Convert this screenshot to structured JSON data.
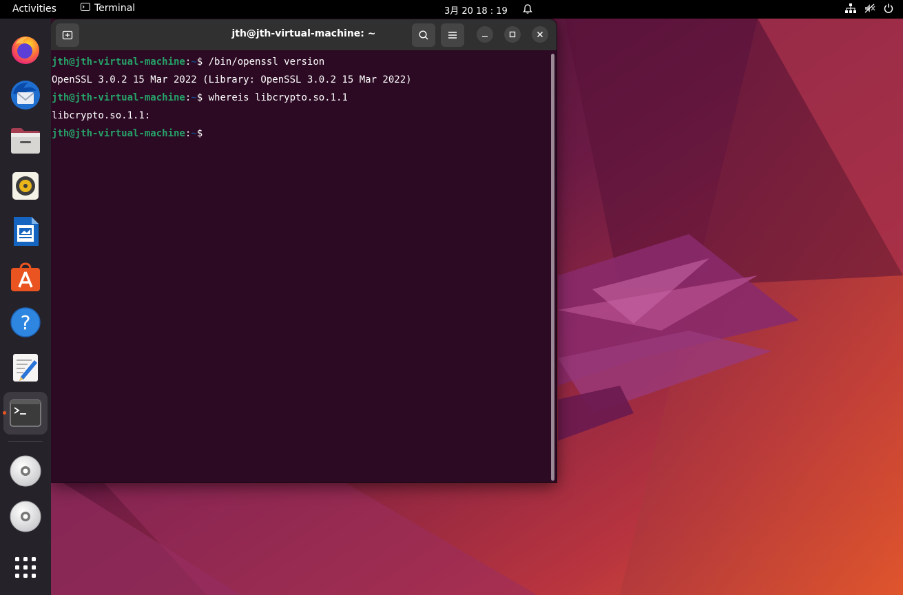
{
  "topbar": {
    "activities": "Activities",
    "app_name": "Terminal",
    "clock": "3月 20  18 : 19",
    "tray_icons": [
      "network-icon",
      "volume-muted-icon",
      "power-icon"
    ]
  },
  "dock": {
    "items": [
      {
        "name": "firefox",
        "icon": "firefox-icon"
      },
      {
        "name": "thunderbird",
        "icon": "thunderbird-icon"
      },
      {
        "name": "files",
        "icon": "files-icon"
      },
      {
        "name": "rhythmbox",
        "icon": "rhythmbox-icon"
      },
      {
        "name": "libreoffice-writer",
        "icon": "writer-icon"
      },
      {
        "name": "ubuntu-software",
        "icon": "software-icon"
      },
      {
        "name": "help",
        "icon": "help-icon"
      },
      {
        "name": "text-editor",
        "icon": "text-editor-icon"
      },
      {
        "name": "terminal",
        "icon": "terminal-icon",
        "running": true
      },
      {
        "name": "disc-1",
        "icon": "cd-icon"
      },
      {
        "name": "disc-2",
        "icon": "cd-icon"
      },
      {
        "name": "show-apps",
        "icon": "app-grid-icon"
      }
    ]
  },
  "terminal": {
    "title": "jth@jth-virtual-machine: ~",
    "lines": [
      {
        "user": "jth@jth-virtual-machine",
        "sep": ":",
        "path": "~",
        "prompt": "$ ",
        "cmd": "/bin/openssl version"
      },
      {
        "output": "OpenSSL 3.0.2 15 Mar 2022 (Library: OpenSSL 3.0.2 15 Mar 2022)"
      },
      {
        "user": "jth@jth-virtual-machine",
        "sep": ":",
        "path": "~",
        "prompt": "$ ",
        "cmd": "whereis libcrypto.so.1.1"
      },
      {
        "output": "libcrypto.so.1.1:"
      },
      {
        "user": "jth@jth-virtual-machine",
        "sep": ":",
        "path": "~",
        "prompt": "$ ",
        "cmd": ""
      }
    ]
  },
  "colors": {
    "terminal_bg": "#2c0a23",
    "prompt_user": "#26a269",
    "prompt_path": "#12488b",
    "accent": "#e95420"
  }
}
